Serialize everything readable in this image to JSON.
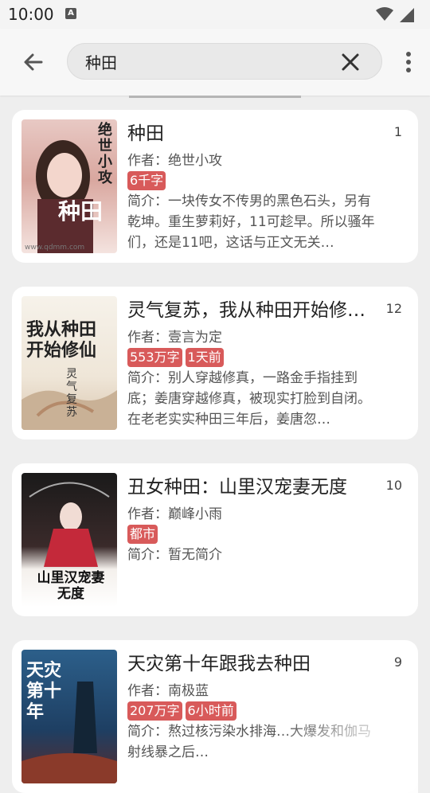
{
  "status_bar": {
    "time": "10:00",
    "notification_badge": "A"
  },
  "search": {
    "value": "种田"
  },
  "results": [
    {
      "title": "种田",
      "index": "1",
      "author": "作者：绝世小攻",
      "tags": [
        "6千字"
      ],
      "intro": "简介：一块传女不传男的黑色石头，另有乾坤。重生萝莉好，11可趁早。所以骚年们，还是11吧，这话与正文无关…",
      "cover_text": "绝世小攻",
      "cover_big": "种田",
      "cover_url": "www.qdmm.com"
    },
    {
      "title": "灵气复苏，我从种田开始修…",
      "index": "12",
      "author": "作者：壹言为定",
      "tags": [
        "553万字",
        "1天前"
      ],
      "intro": "简介：别人穿越修真，一路金手指挂到底；姜唐穿越修真，被现实打脸到自闭。在老老实实种田三年后，姜唐忽…",
      "cover_text": "我从种田开始修仙",
      "cover_sub": "灵气复苏"
    },
    {
      "title": "丑女种田：山里汉宠妻无度",
      "index": "10",
      "author": "作者：巅峰小雨",
      "tags": [
        "都市"
      ],
      "intro": "简介：暂无简介",
      "cover_text": "山里汉宠妻无度"
    },
    {
      "title": "天灾第十年跟我去种田",
      "index": "9",
      "author": "作者：南极蓝",
      "tags": [
        "207万字",
        "6小时前"
      ],
      "intro": "简介：熬过核污染水排海…大爆发和伽马射线暴之后…",
      "cover_text": "天灾第十年"
    }
  ]
}
